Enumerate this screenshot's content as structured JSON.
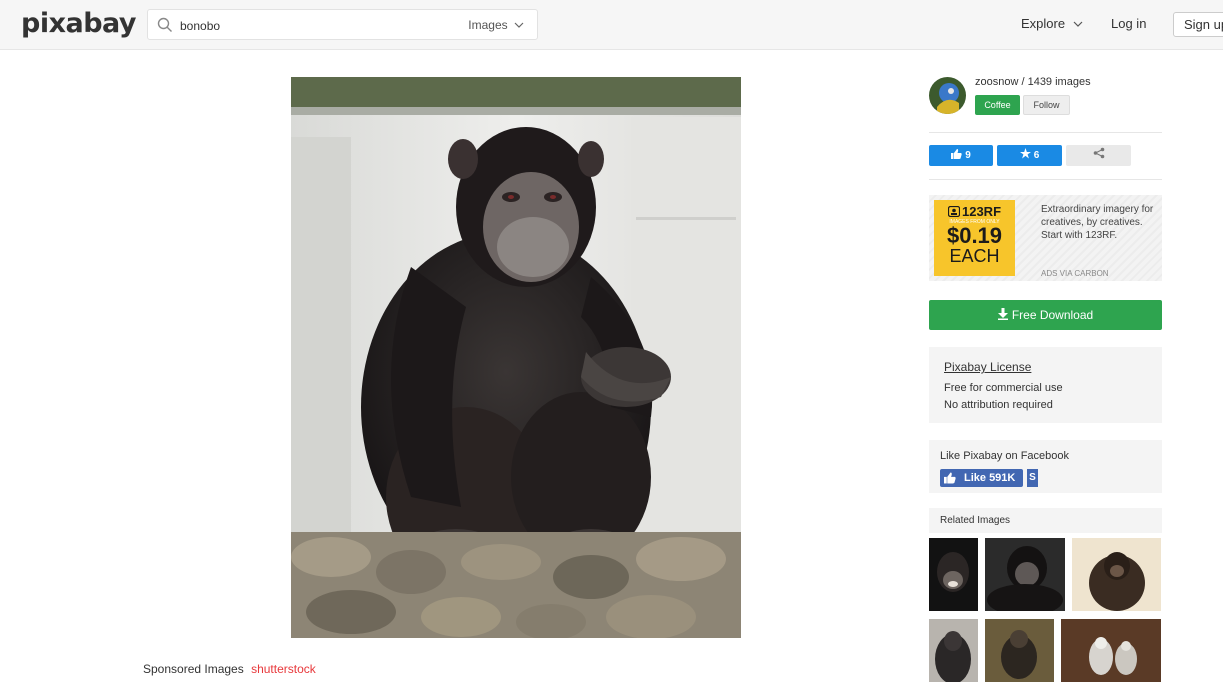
{
  "header": {
    "logo": "pixabay",
    "search_value": "bonobo",
    "search_type": "Images",
    "explore": "Explore",
    "login": "Log in",
    "signup": "Sign up"
  },
  "author": {
    "name_count": "zoosnow / 1439 images",
    "coffee": "Coffee",
    "follow": "Follow"
  },
  "stats": {
    "likes": "9",
    "favorites": "6"
  },
  "ad": {
    "brand": "123RF",
    "small": "IMAGES FROM ONLY",
    "price": "$0.19",
    "each": "EACH",
    "text": "Extraordinary imagery for creatives, by creatives. Start with 123RF.",
    "via": "ADS VIA CARBON"
  },
  "download": "Free Download",
  "license": {
    "title": "Pixabay License",
    "line1": "Free for commercial use",
    "line2": "No attribution required"
  },
  "facebook": {
    "title": "Like Pixabay on Facebook",
    "like": "Like 591K",
    "share": "S"
  },
  "related": {
    "title": "Related Images"
  },
  "sponsored": {
    "label": "Sponsored Images",
    "brand": "shutterstock"
  },
  "colors": {
    "green": "#2ea44f",
    "blue": "#1a8ae4",
    "facebook": "#4267b2",
    "ad_yellow": "#f7c52b"
  }
}
